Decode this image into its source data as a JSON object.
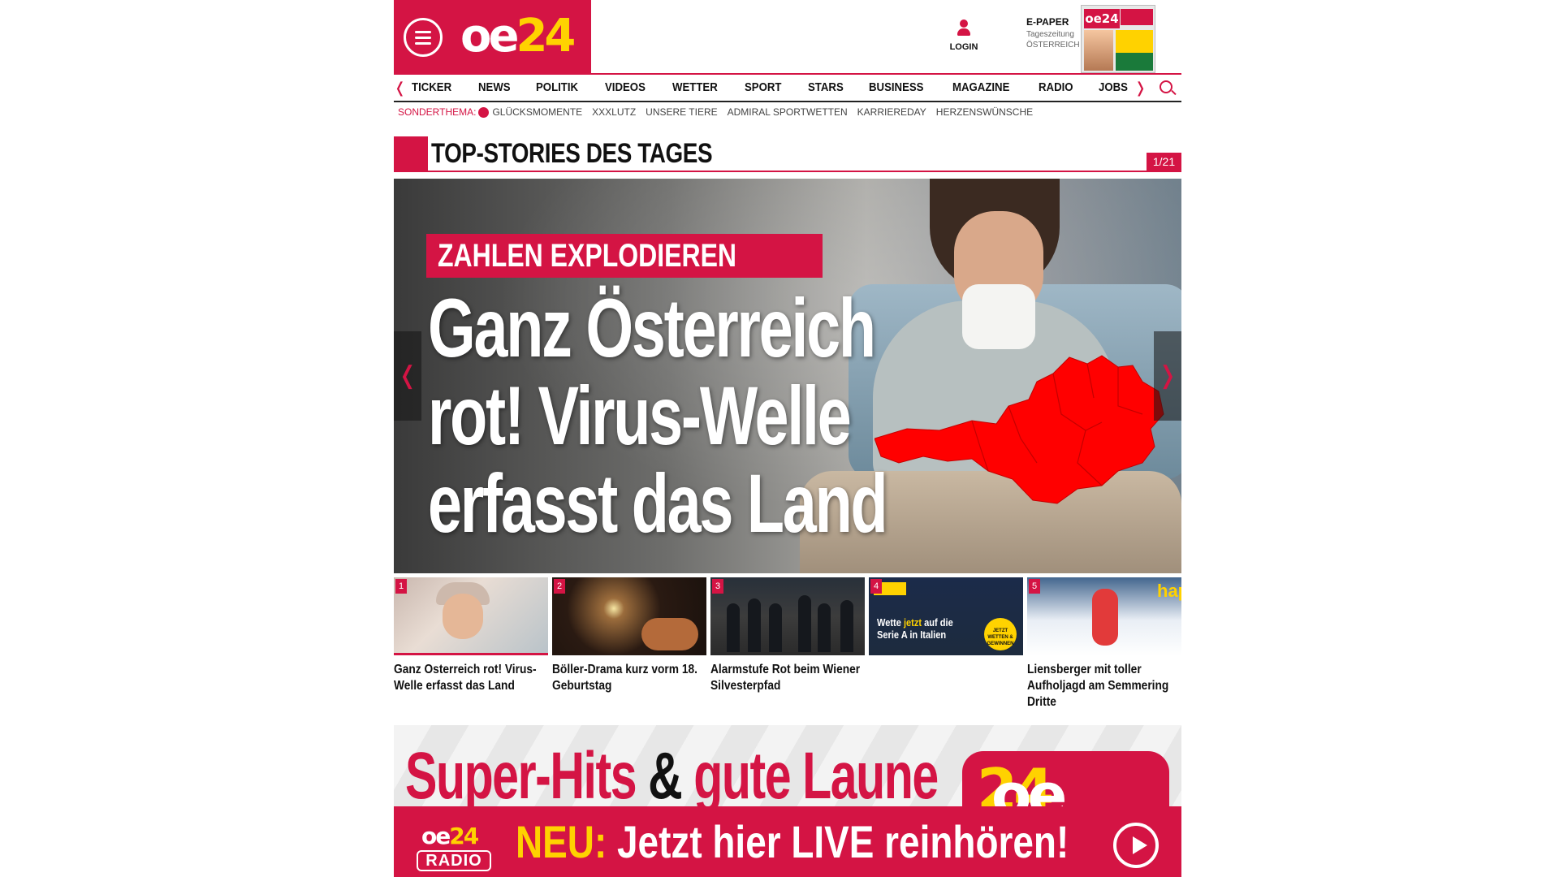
{
  "header": {
    "logo": {
      "oe": "oe",
      "num": "24"
    },
    "login_label": "LOGIN",
    "epaper": {
      "title": "E-PAPER",
      "line1": "Tageszeitung",
      "line2": "ÖSTERREICH"
    }
  },
  "nav": {
    "items": [
      "TICKER",
      "NEWS",
      "POLITIK",
      "VIDEOS",
      "WETTER",
      "SPORT",
      "STARS",
      "BUSINESS",
      "MAGAZINE",
      "RADIO",
      "JOBS"
    ]
  },
  "subnav": {
    "sonder_label": "SONDERTHEMA:",
    "items": [
      "GLÜCKSMOMENTE",
      "XXXLUTZ",
      "UNSERE TIERE",
      "ADMIRAL SPORTWETTEN",
      "KARRIEREDAY",
      "HERZENSWÜNSCHE"
    ]
  },
  "topstories": {
    "title": "TOP-STORIES DES TAGES",
    "counter": "1/21"
  },
  "hero": {
    "kicker": "ZAHLEN EXPLODIEREN",
    "headline": "Ganz Österreich rot! Virus-Welle erfasst das Land"
  },
  "thumbs": [
    {
      "num": "1",
      "title": "Ganz Osterreich rot! Virus-Welle erfasst das Land"
    },
    {
      "num": "2",
      "title": "Böller-Drama kurz vorm 18. Geburtstag"
    },
    {
      "num": "3",
      "title": "Alarmstufe Rot beim Wiener Silvesterpfad"
    },
    {
      "num": "4",
      "title": "",
      "ad_text_1": "Wette ",
      "ad_text_hl": "jetzt",
      "ad_text_2": " auf die Serie A in Italien",
      "ad_cta": "JETZT WETTEN & GEWINNEN"
    },
    {
      "num": "5",
      "title": "Liensberger mit toller Aufholjagd am Semmering Dritte",
      "img_text": "hap"
    }
  ],
  "banner": {
    "headline_1": "Super-Hits ",
    "headline_amp": "&",
    "headline_2": " gute Laune",
    "logo_oe": "oe",
    "logo_num": "24",
    "radio_oe": "oe",
    "radio_num": "24",
    "radio_label": "RADIO",
    "cta_neu": "NEU:",
    "cta_rest": " Jetzt hier LIVE reinhören!"
  },
  "colors": {
    "brand_red": "#d41444",
    "brand_yellow": "#ffd200",
    "map_red": "#ff0000"
  }
}
